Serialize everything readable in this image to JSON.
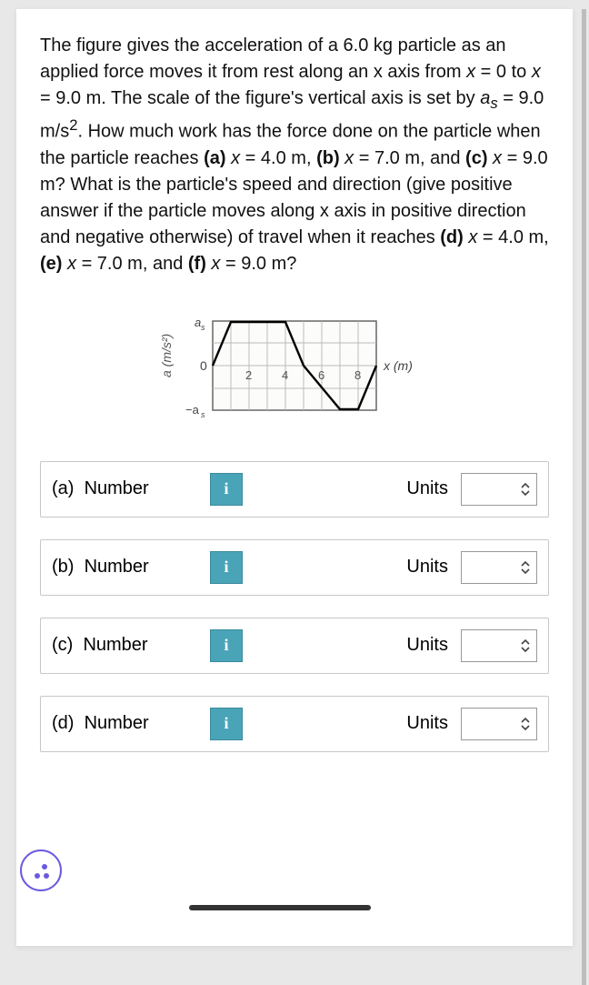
{
  "problem": {
    "text_html": "The figure gives the acceleration of a 6.0 kg particle as an applied force moves it from rest along an x axis from <span class='it'>x</span> = 0 to <span class='it'>x</span> = 9.0 m. The scale of the figure's vertical axis is set by <span class='it'>a<sub>s</sub></span> = 9.0 m/s<sup>2</sup>. How much work has the force done on the particle when the particle reaches <b>(a)</b> <span class='it'>x</span> = 4.0 m, <b>(b)</b> <span class='it'>x</span> = 7.0 m, and <b>(c)</b> <span class='it'>x</span> = 9.0 m? What is the particle's speed and direction (give positive answer if the particle moves along x axis in positive direction and negative otherwise) of travel when it reaches <b>(d)</b> <span class='it'>x</span> = 4.0 m, <b>(e)</b> <span class='it'>x</span> = 7.0 m, and <b>(f)</b> <span class='it'>x</span> = 9.0 m?",
    "mass_kg": 6.0,
    "x_start_m": 0,
    "x_end_m": 9.0,
    "a_s_m_per_s2": 9.0
  },
  "chart_data": {
    "type": "line",
    "xlabel": "x (m)",
    "ylabel": "a (m/s²)",
    "x_ticks": [
      0,
      2,
      4,
      6,
      8
    ],
    "y_ticks_labels": [
      "-a_s",
      "0",
      "a_s"
    ],
    "y_tick_values": [
      -9.0,
      0,
      9.0
    ],
    "xlim": [
      0,
      9
    ],
    "ylim": [
      -9.0,
      9.0
    ],
    "series": [
      {
        "name": "acceleration",
        "x": [
          0,
          1,
          4,
          5,
          7,
          8,
          9
        ],
        "y": [
          0,
          9.0,
          9.0,
          0,
          -9.0,
          -9.0,
          0
        ]
      }
    ]
  },
  "rows": [
    {
      "part": "(a)",
      "label_number": "Number",
      "label_units": "Units",
      "info_icon": "i"
    },
    {
      "part": "(b)",
      "label_number": "Number",
      "label_units": "Units",
      "info_icon": "i"
    },
    {
      "part": "(c)",
      "label_number": "Number",
      "label_units": "Units",
      "info_icon": "i"
    },
    {
      "part": "(d)",
      "label_number": "Number",
      "label_units": "Units",
      "info_icon": "i"
    }
  ]
}
